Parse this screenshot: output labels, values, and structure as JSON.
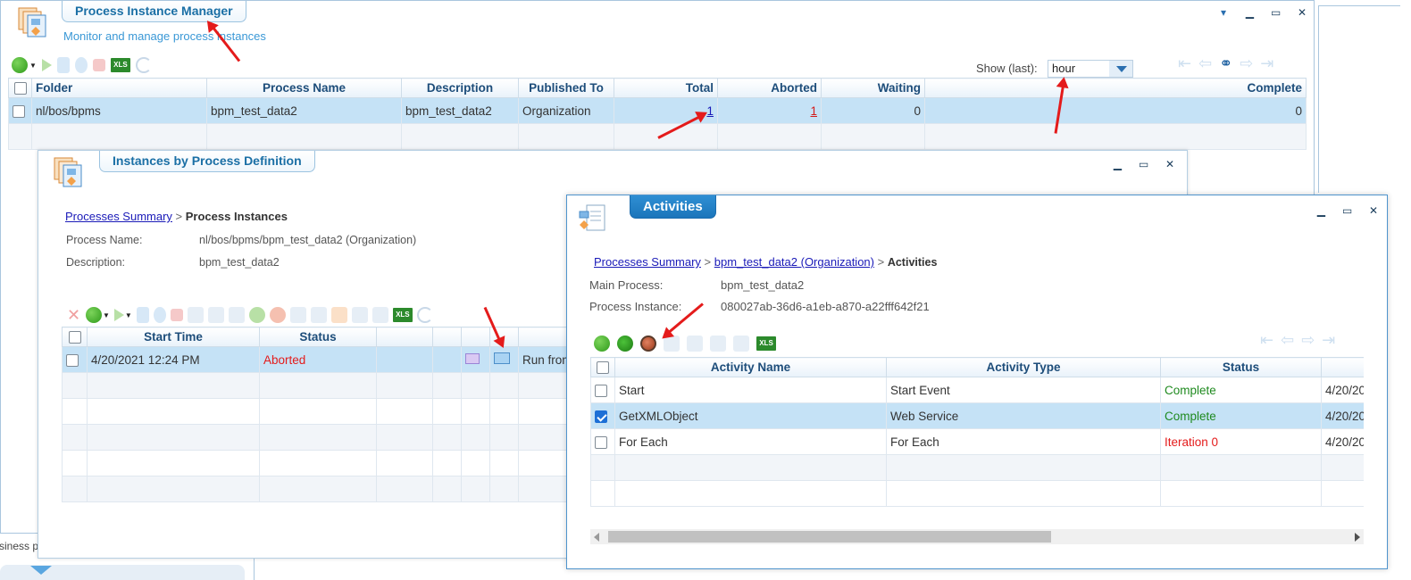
{
  "pim": {
    "title": "Process Instance Manager",
    "subtitle": "Monitor and manage process instances",
    "show_last_label": "Show (last):",
    "show_last_value": "hour",
    "columns": [
      "Folder",
      "Process Name",
      "Description",
      "Published To",
      "Total",
      "Aborted",
      "Waiting",
      "Complete"
    ],
    "row": {
      "folder": "nl/bos/bpms",
      "process_name": "bpm_test_data2",
      "description": "bpm_test_data2",
      "published_to": "Organization",
      "total": "1",
      "aborted": "1",
      "waiting": "0",
      "complete": "0"
    }
  },
  "ipd": {
    "title": "Instances by Process Definition",
    "crumb_link": "Processes Summary",
    "crumb_sep": ">",
    "crumb_current": "Process Instances",
    "process_name_label": "Process Name:",
    "process_name_value": "nl/bos/bpms/bpm_test_data2 (Organization)",
    "description_label": "Description:",
    "description_value": "bpm_test_data2",
    "columns": [
      "Start Time",
      "Status"
    ],
    "row": {
      "start_time": "4/20/2021 12:24 PM",
      "status": "Aborted",
      "action": "Run from"
    }
  },
  "act": {
    "title": "Activities",
    "crumb_link1": "Processes Summary",
    "crumb_sep": ">",
    "crumb_link2": "bpm_test_data2 (Organization)",
    "crumb_current": "Activities",
    "main_process_label": "Main Process:",
    "main_process_value": "bpm_test_data2",
    "instance_label": "Process Instance:",
    "instance_value": "080027ab-36d6-a1eb-a870-a22fff642f21",
    "columns": [
      "Activity Name",
      "Activity Type",
      "Status"
    ],
    "rows": [
      {
        "name": "Start",
        "type": "Start Event",
        "status": "Complete",
        "date": "4/20/20"
      },
      {
        "name": "GetXMLObject",
        "type": "Web Service",
        "status": "Complete",
        "date": "4/20/20"
      },
      {
        "name": "For Each",
        "type": "For Each",
        "status": "Iteration 0",
        "date": "4/20/20"
      }
    ]
  },
  "footer_text": "siness p",
  "window_controls": {
    "minimize": "▁",
    "maximize": "▭",
    "close": "✕",
    "menu": "▾"
  },
  "colors": {
    "accent": "#1b75bb",
    "selected_row": "#c5e2f6",
    "complete": "#1f8a1f",
    "aborted": "#e41b1b",
    "annotation_arrow": "#e41b1b"
  }
}
